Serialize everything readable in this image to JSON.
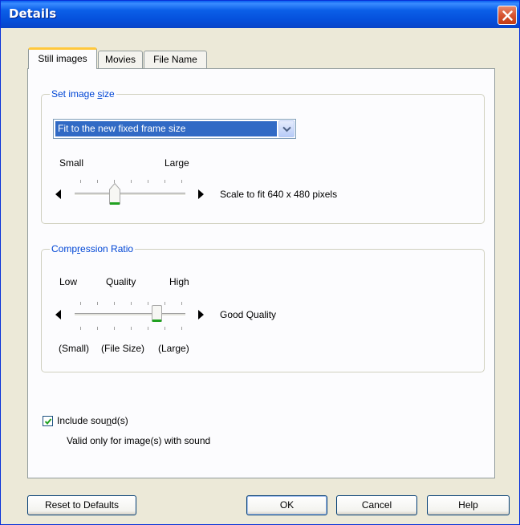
{
  "window": {
    "title": "Details"
  },
  "tabs": [
    {
      "label": "Still images",
      "active": true
    },
    {
      "label": "Movies",
      "active": false
    },
    {
      "label": "File Name",
      "active": false
    }
  ],
  "image_size": {
    "group_label": "Set image size",
    "dropdown_value": "Fit to the new fixed frame size",
    "slider_min_label": "Small",
    "slider_max_label": "Large",
    "slider_value_text": "Scale to fit 640 x 480 pixels",
    "slider_position_fraction": 0.33
  },
  "compression": {
    "group_label": "Compression Ratio",
    "top_left_label": "Low",
    "top_mid_label": "Quality",
    "top_right_label": "High",
    "bottom_left_label": "(Small)",
    "bottom_mid_label": "(File Size)",
    "bottom_right_label": "(Large)",
    "slider_value_text": "Good Quality",
    "slider_position_fraction": 0.75
  },
  "sound": {
    "checkbox_label": "Include sound(s)",
    "checked": true,
    "note": "Valid only for image(s) with sound"
  },
  "buttons": {
    "reset": "Reset to Defaults",
    "ok": "OK",
    "cancel": "Cancel",
    "help": "Help"
  },
  "colors": {
    "title_bar": "#0a5ff0",
    "group_label": "#0046d5",
    "selection": "#316ac5",
    "slider_accent": "#21a121",
    "close_button": "#d75431"
  }
}
